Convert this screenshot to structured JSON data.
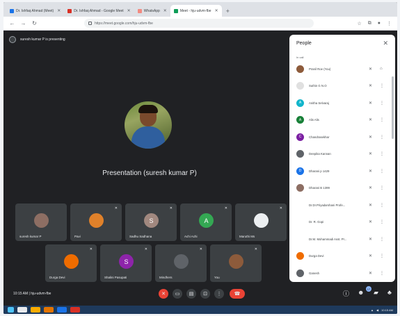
{
  "browser": {
    "tabs": [
      {
        "label": "Dr. Ishfaq Ahmad (Meet)",
        "color": "#1a73e8",
        "active": false
      },
      {
        "label": "Dr. Ishfaq Ahmad - Google Meet",
        "color": "#d93025",
        "active": false
      },
      {
        "label": "WhatsApp",
        "color": "#f28b82",
        "active": false
      },
      {
        "label": "Meet - hju-udvm-fbe",
        "color": "#0f9d58",
        "active": true
      }
    ],
    "new_tab": "+",
    "url": "https://meet.google.com/hju-udvm-fbe"
  },
  "meet": {
    "presenting_banner": "suresh kumar P is presenting",
    "main_title": "Presentation (suresh kumar P)",
    "tiles_row1": [
      {
        "name": "suresh kumar P",
        "initial": "",
        "color": "#8d6e63",
        "kind": "photo"
      },
      {
        "name": "Pavi",
        "initial": "",
        "color": "#e0812a",
        "kind": "photo"
      },
      {
        "name": "Sadhu Sadhana",
        "initial": "S",
        "color": "#a1887f",
        "kind": "letter"
      },
      {
        "name": "Achi Achi",
        "initial": "A",
        "color": "#34a853",
        "kind": "letter"
      },
      {
        "name": "Maruthi Ms",
        "initial": "",
        "color": "#eceff1",
        "kind": "photo"
      }
    ],
    "tiles_row2": [
      {
        "name": "Durga Devi",
        "initial": "",
        "color": "#ef6c00",
        "kind": "photo"
      },
      {
        "name": "Shalini Pasupati",
        "initial": "S",
        "color": "#8e24aa",
        "kind": "letter"
      },
      {
        "name": "Mindhers",
        "initial": "",
        "color": "#5f6368",
        "kind": "photo"
      },
      {
        "name": "You",
        "initial": "",
        "color": "#8d5b3b",
        "kind": "photo"
      }
    ],
    "clock": "10:15 AM  |  hju-udvm-fbe",
    "controls": [
      "mic",
      "cam",
      "cc",
      "present",
      "more",
      "end-call"
    ],
    "people_count": "17"
  },
  "people": {
    "title": "People",
    "section": "In call",
    "rows": [
      {
        "name": "Pranil Roe (You)",
        "color": "#8d5b3b",
        "initial": ""
      },
      {
        "name": "Suthin G N.O",
        "color": "#e0e0e0",
        "initial": ""
      },
      {
        "name": "Anitha Selvaraj",
        "color": "#12b5cb",
        "initial": "A"
      },
      {
        "name": "Alis Alis",
        "color": "#188038",
        "initial": "A"
      },
      {
        "name": "Chandrasekhar",
        "color": "#7b1fa2",
        "initial": "C"
      },
      {
        "name": "Deepika Kannan",
        "color": "#5f6368",
        "initial": ""
      },
      {
        "name": "Dharani p 1429",
        "color": "#1a73e8",
        "initial": "D"
      },
      {
        "name": "Dharani B 1399",
        "color": "#8d6e63",
        "initial": ""
      },
      {
        "name": "Dr.Dr.Priyadarshani Profe...",
        "color": "",
        "initial": ""
      },
      {
        "name": "Dr. R. Gopi",
        "color": "",
        "initial": ""
      },
      {
        "name": "Dr.M. Mohammadi Asst. Pr...",
        "color": "",
        "initial": ""
      },
      {
        "name": "Durga Devi",
        "color": "#ef6c00",
        "initial": ""
      },
      {
        "name": "Ganesh",
        "color": "#5f6368",
        "initial": ""
      }
    ]
  },
  "taskbar": {
    "tray_time": "10:15 AM"
  }
}
